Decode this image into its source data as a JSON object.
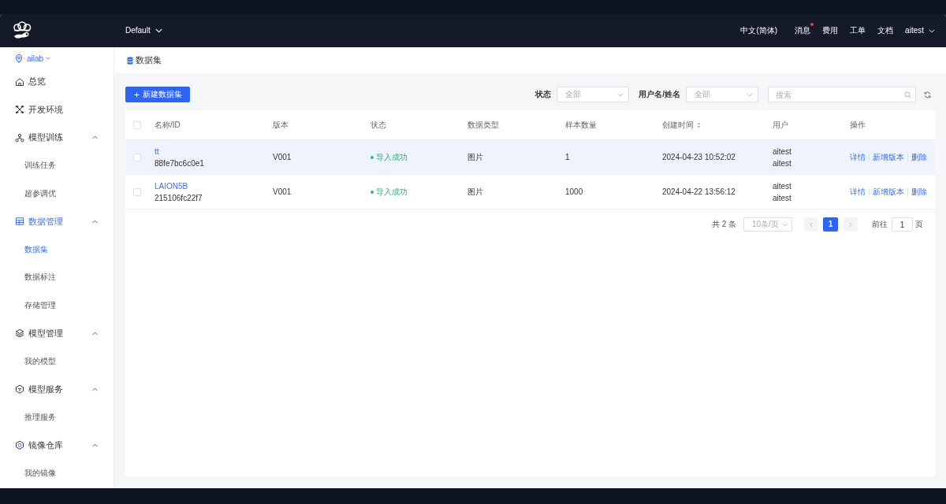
{
  "header": {
    "workspace": "Default",
    "links": [
      {
        "kind": "language",
        "label": "中文(简体)",
        "badge": false
      },
      {
        "kind": "link",
        "label": "消息",
        "badge": true
      },
      {
        "kind": "link",
        "label": "费用",
        "badge": false
      },
      {
        "kind": "link",
        "label": "工单",
        "badge": false
      },
      {
        "kind": "link",
        "label": "文档",
        "badge": false
      }
    ],
    "user": "aitest"
  },
  "sidebar": {
    "location": "ailab",
    "items": [
      {
        "kind": "link",
        "label": "总览",
        "selected": false
      },
      {
        "kind": "link",
        "label": "开发环境",
        "selected": false
      },
      {
        "kind": "group",
        "label": "模型训练",
        "selected": false,
        "expanded": true,
        "children": [
          {
            "label": "训练任务",
            "selected": false
          },
          {
            "label": "超参调优",
            "selected": false
          }
        ]
      },
      {
        "kind": "group",
        "label": "数据管理",
        "selected": true,
        "expanded": true,
        "children": [
          {
            "label": "数据集",
            "selected": true
          },
          {
            "label": "数据标注",
            "selected": false
          },
          {
            "label": "存储管理",
            "selected": false
          }
        ]
      },
      {
        "kind": "group",
        "label": "模型管理",
        "selected": false,
        "expanded": true,
        "children": [
          {
            "label": "我的模型",
            "selected": false
          }
        ]
      },
      {
        "kind": "group",
        "label": "模型服务",
        "selected": false,
        "expanded": true,
        "children": [
          {
            "label": "推理服务",
            "selected": false
          }
        ]
      },
      {
        "kind": "group",
        "label": "镜像仓库",
        "selected": false,
        "expanded": true,
        "children": [
          {
            "label": "我的镜像",
            "selected": false
          }
        ]
      }
    ]
  },
  "page": {
    "title": "数据集"
  },
  "toolbar": {
    "create_button": "新建数据集",
    "filters": [
      {
        "label": "状态",
        "placeholder": "全部"
      },
      {
        "label": "用户名/姓名",
        "placeholder": "全部"
      }
    ],
    "search": {
      "placeholder": "搜索"
    }
  },
  "table": {
    "select_all": {
      "checked": false
    },
    "columns": [
      {
        "label": "名称/ID",
        "sortable": false
      },
      {
        "label": "版本",
        "sortable": false
      },
      {
        "label": "状态",
        "sortable": false
      },
      {
        "label": "数据类型",
        "sortable": false
      },
      {
        "label": "样本数量",
        "sortable": false
      },
      {
        "label": "创建时间",
        "sortable": true
      },
      {
        "label": "用户",
        "sortable": false
      },
      {
        "label": "操作",
        "sortable": false
      }
    ],
    "rows": [
      {
        "highlighted": true,
        "checked": false,
        "name": "tt",
        "id": "88fe7bc6c0e1",
        "version": "V001",
        "status": {
          "label": "导入成功",
          "color": "#22c06c"
        },
        "data_type": "图片",
        "sample_count": "1",
        "created": "2024-04-23 10:52:02",
        "users": [
          "aitest",
          "aitest"
        ],
        "actions": [
          "详情",
          "新增版本",
          "删除"
        ]
      },
      {
        "highlighted": false,
        "checked": false,
        "name": "LAION5B",
        "id": "215106fc22f7",
        "version": "V001",
        "status": {
          "label": "导入成功",
          "color": "#22c06c"
        },
        "data_type": "图片",
        "sample_count": "1000",
        "created": "2024-04-22 13:56:12",
        "users": [
          "aitest",
          "aitest"
        ],
        "actions": [
          "详情",
          "新增版本",
          "删除"
        ]
      }
    ]
  },
  "pagination": {
    "total": "共 2 条",
    "page_size": "10条/页",
    "pages": [
      {
        "label": "1",
        "selected": true
      }
    ],
    "goto_label": "前往",
    "goto_value": "1",
    "goto_suffix": "页"
  }
}
